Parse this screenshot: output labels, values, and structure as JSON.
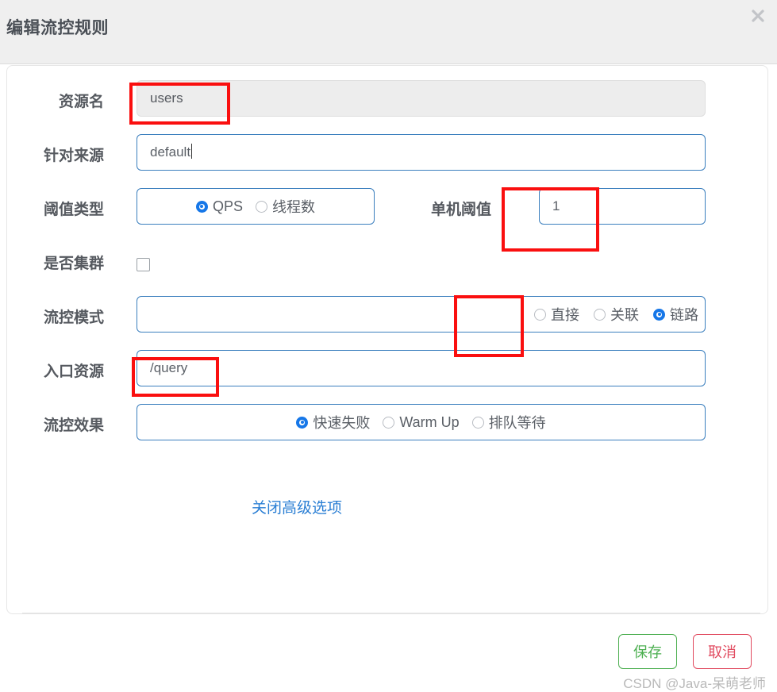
{
  "dialog": {
    "title": "编辑流控规则",
    "close_icon": "close-icon"
  },
  "form": {
    "rows": [
      {
        "label": "资源名",
        "value": "users"
      },
      {
        "label": "针对来源",
        "value": "default"
      },
      {
        "label": "阈值类型",
        "value": ""
      },
      {
        "label": "是否集群",
        "value": ""
      },
      {
        "label": "流控模式",
        "value": ""
      },
      {
        "label": "入口资源",
        "value": "/query"
      },
      {
        "label": "流控效果",
        "value": ""
      }
    ],
    "resource_name": {
      "label": "资源名",
      "value": "users",
      "disabled": true
    },
    "origin": {
      "label": "针对来源",
      "value": "default"
    },
    "threshold_type": {
      "label": "阈值类型",
      "options": [
        "QPS",
        "线程数"
      ],
      "selected": "QPS"
    },
    "single_threshold": {
      "label": "单机阈值",
      "value": "1"
    },
    "cluster": {
      "label": "是否集群",
      "checked": false
    },
    "flow_mode": {
      "label": "流控模式",
      "options": [
        "直接",
        "关联",
        "链路"
      ],
      "selected": "链路"
    },
    "entry_resource": {
      "label": "入口资源",
      "value": "/query"
    },
    "flow_effect": {
      "label": "流控效果",
      "options": [
        "快速失败",
        "Warm Up",
        "排队等待"
      ],
      "selected": "快速失败"
    },
    "advanced_link": "关闭高级选项"
  },
  "footer": {
    "save_label": "保存",
    "cancel_label": "取消"
  },
  "watermark": "CSDN @Java-呆萌老师",
  "colors": {
    "accent_blue": "#1677e8",
    "border_blue": "#3b7fbe",
    "annotation_red": "#fa0f0f",
    "save_green": "#4caf50",
    "cancel_red": "#e14a5f",
    "header_bg": "#efefef"
  }
}
